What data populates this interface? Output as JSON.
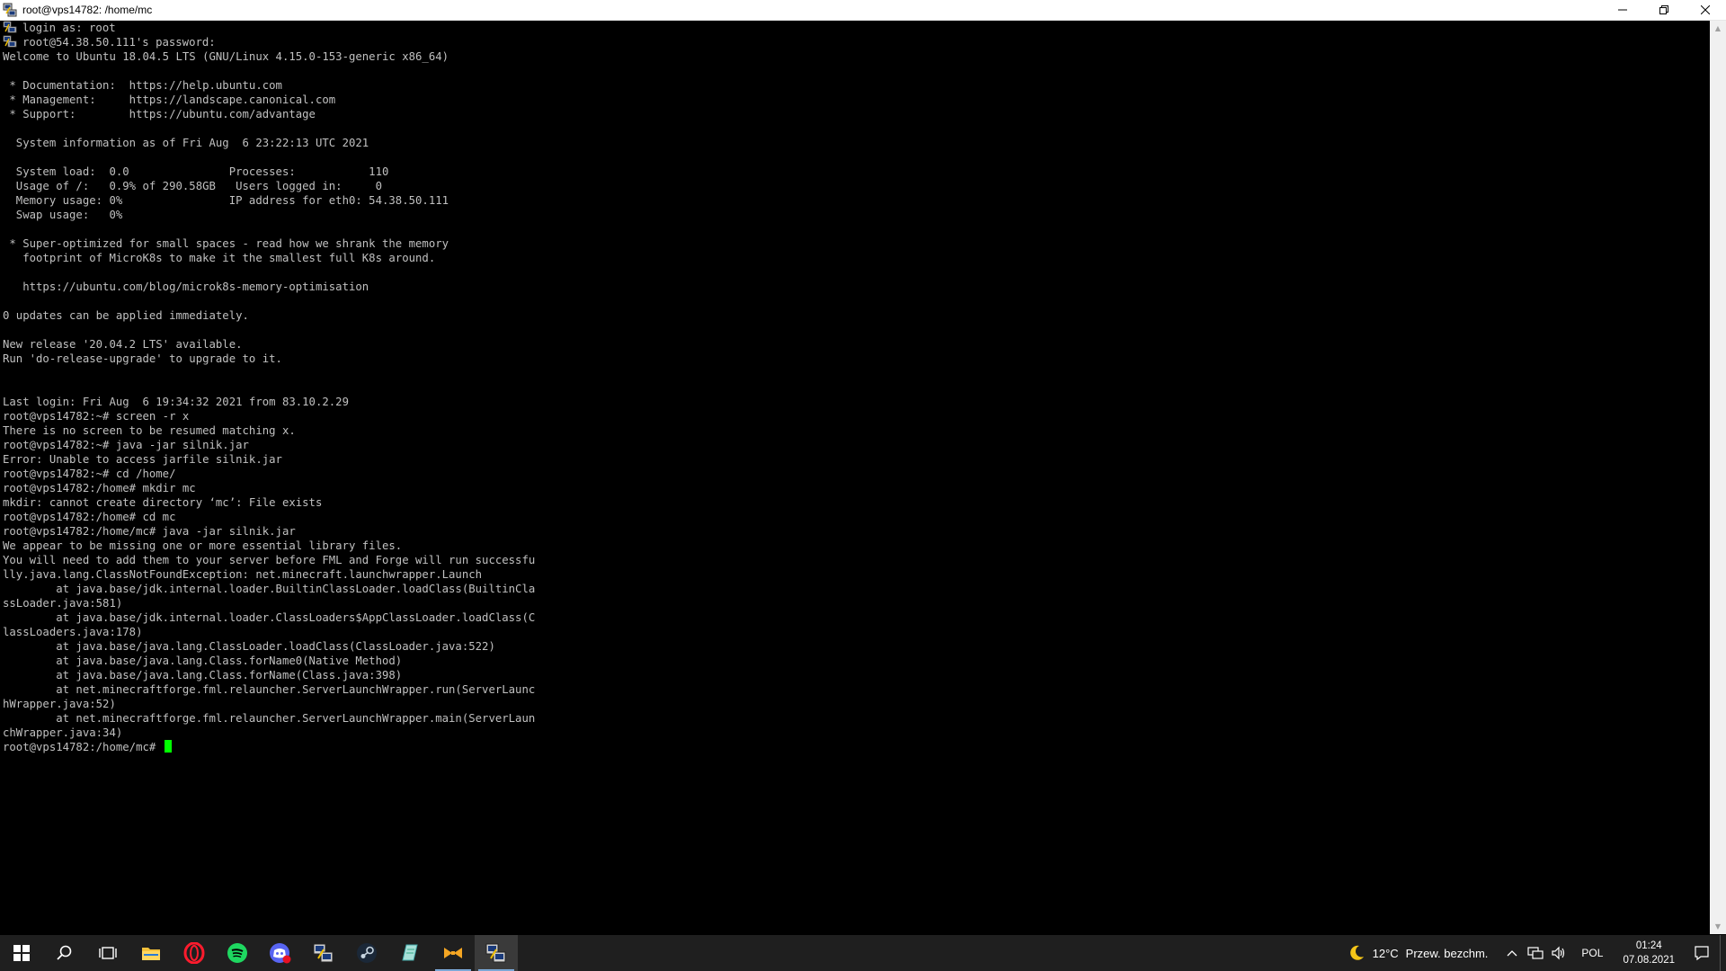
{
  "window": {
    "title": "root@vps14782: /home/mc",
    "minimize": "—",
    "restore": "❐",
    "close": "✕"
  },
  "terminal": {
    "lines": [
      "login as: root",
      "root@54.38.50.111's password:",
      "Welcome to Ubuntu 18.04.5 LTS (GNU/Linux 4.15.0-153-generic x86_64)",
      "",
      " * Documentation:  https://help.ubuntu.com",
      " * Management:     https://landscape.canonical.com",
      " * Support:        https://ubuntu.com/advantage",
      "",
      "  System information as of Fri Aug  6 23:22:13 UTC 2021",
      "",
      "  System load:  0.0               Processes:           110",
      "  Usage of /:   0.9% of 290.58GB   Users logged in:     0",
      "  Memory usage: 0%                IP address for eth0: 54.38.50.111",
      "  Swap usage:   0%",
      "",
      " * Super-optimized for small spaces - read how we shrank the memory",
      "   footprint of MicroK8s to make it the smallest full K8s around.",
      "",
      "   https://ubuntu.com/blog/microk8s-memory-optimisation",
      "",
      "0 updates can be applied immediately.",
      "",
      "New release '20.04.2 LTS' available.",
      "Run 'do-release-upgrade' to upgrade to it.",
      "",
      "",
      "Last login: Fri Aug  6 19:34:32 2021 from 83.10.2.29",
      "root@vps14782:~# screen -r x",
      "There is no screen to be resumed matching x.",
      "root@vps14782:~# java -jar silnik.jar",
      "Error: Unable to access jarfile silnik.jar",
      "root@vps14782:~# cd /home/",
      "root@vps14782:/home# mkdir mc",
      "mkdir: cannot create directory ‘mc’: File exists",
      "root@vps14782:/home# cd mc",
      "root@vps14782:/home/mc# java -jar silnik.jar",
      "We appear to be missing one or more essential library files.",
      "You will need to add them to your server before FML and Forge will run successfu",
      "lly.java.lang.ClassNotFoundException: net.minecraft.launchwrapper.Launch",
      "        at java.base/jdk.internal.loader.BuiltinClassLoader.loadClass(BuiltinCla",
      "ssLoader.java:581)",
      "        at java.base/jdk.internal.loader.ClassLoaders$AppClassLoader.loadClass(C",
      "lassLoaders.java:178)",
      "        at java.base/java.lang.ClassLoader.loadClass(ClassLoader.java:522)",
      "        at java.base/java.lang.Class.forName0(Native Method)",
      "        at java.base/java.lang.Class.forName(Class.java:398)",
      "        at net.minecraftforge.fml.relauncher.ServerLaunchWrapper.run(ServerLaunc",
      "hWrapper.java:52)",
      "        at net.minecraftforge.fml.relauncher.ServerLaunchWrapper.main(ServerLaun",
      "chWrapper.java:34)"
    ],
    "prompt": "root@vps14782:/home/mc# "
  },
  "taskbar": {
    "apps": [
      {
        "name": "start-button",
        "icon": "windows-logo-icon",
        "running": false
      },
      {
        "name": "search-button",
        "icon": "search-icon",
        "running": false
      },
      {
        "name": "task-view-button",
        "icon": "task-view-icon",
        "running": false
      },
      {
        "name": "file-explorer",
        "icon": "folder-icon",
        "running": false
      },
      {
        "name": "opera",
        "icon": "opera-icon",
        "running": false
      },
      {
        "name": "spotify",
        "icon": "spotify-icon",
        "running": false
      },
      {
        "name": "discord",
        "icon": "discord-icon",
        "running": false
      },
      {
        "name": "putty-config",
        "icon": "putty-config-icon",
        "running": false
      },
      {
        "name": "steam",
        "icon": "steam-icon",
        "running": false
      },
      {
        "name": "notepad-plus",
        "icon": "notepad-icon",
        "running": false
      },
      {
        "name": "bluestacks",
        "icon": "bowtie-icon",
        "running": true
      },
      {
        "name": "putty",
        "icon": "putty-icon",
        "running": true
      }
    ]
  },
  "tray": {
    "temperature": "12°C",
    "weather": "Przew. bezchm.",
    "language": "POL",
    "time": "01:24",
    "date": "07.08.2021"
  },
  "colors": {
    "terminal_bg": "#000000",
    "terminal_fg": "#c0c0c0",
    "cursor": "#00ff00",
    "taskbar_bg": "#1f1f1f"
  }
}
